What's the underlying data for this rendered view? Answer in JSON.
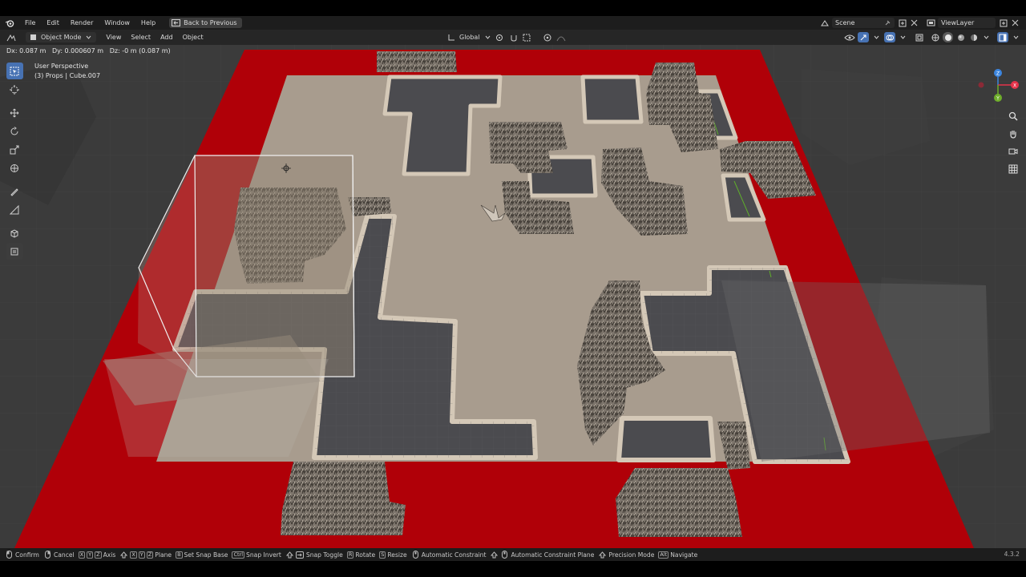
{
  "menubar": {
    "items": [
      "File",
      "Edit",
      "Render",
      "Window",
      "Help"
    ],
    "back_button": "Back to Previous",
    "scene_label": "Scene",
    "viewlayer_label": "ViewLayer"
  },
  "header": {
    "mode": "Object Mode",
    "menus": [
      "View",
      "Select",
      "Add",
      "Object"
    ],
    "orientation": "Global"
  },
  "viewport": {
    "transform_status": "Dx: 0.087 m   Dy: 0.000607 m   Dz: -0 m (0.087 m)",
    "perspective": "User Perspective",
    "collection_object": "(3) Props | Cube.007",
    "gizmo_axes": {
      "z": "Z",
      "x": "X",
      "y": "Y"
    }
  },
  "statusbar": {
    "confirm": "Confirm",
    "cancel": "Cancel",
    "axis_keys": [
      "X",
      "Y",
      "Z"
    ],
    "axis": "Axis",
    "plane_keys": [
      "X",
      "Y",
      "Z"
    ],
    "plane": "Plane",
    "snap_base_key": "B",
    "snap_base": "Set Snap Base",
    "ctrl_key": "Ctrl",
    "snap_invert": "Snap Invert",
    "snap_toggle": "Snap Toggle",
    "rotate_key": "R",
    "rotate": "Rotate",
    "resize_key": "S",
    "resize": "Resize",
    "auto_constraint": "Automatic Constraint",
    "auto_constraint_plane": "Automatic Constraint Plane",
    "precision_mode": "Precision Mode",
    "alt_key": "Alt",
    "navigate": "Navigate",
    "version": "4.3.2"
  },
  "colors": {
    "accent": "#4772b3",
    "red_plane": "#b00008",
    "floor": "#a89c8e",
    "trench": "#4b4b4f",
    "rail": "#d4c8b7",
    "gizmo_x": "#e5324a",
    "gizmo_y": "#6fae2b",
    "gizmo_z": "#3c86e0"
  }
}
